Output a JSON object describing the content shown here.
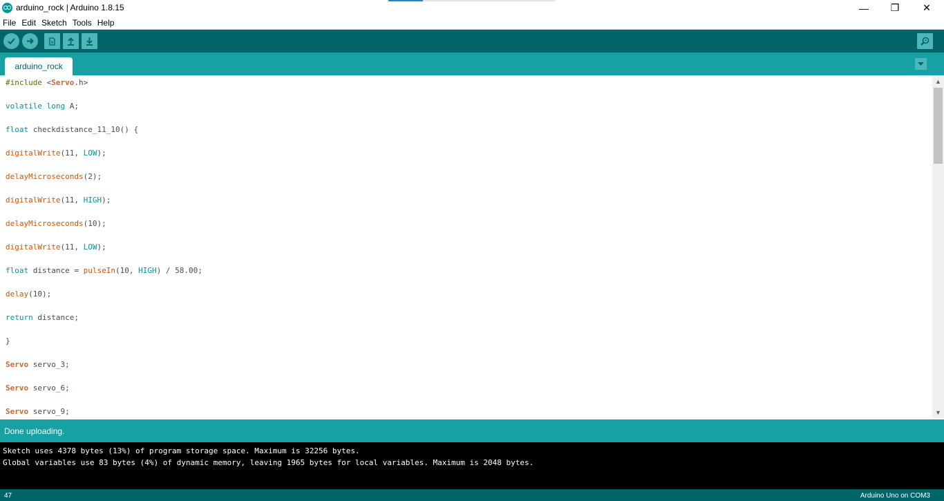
{
  "window": {
    "title": "arduino_rock | Arduino 1.8.15",
    "minimize_glyph": "—",
    "maximize_glyph": "❐",
    "close_glyph": "✕"
  },
  "menu": [
    "File",
    "Edit",
    "Sketch",
    "Tools",
    "Help"
  ],
  "toolbar": {
    "verify_icon": "checkmark-icon",
    "upload_icon": "arrow-right-icon",
    "new_icon": "document-icon",
    "open_icon": "arrow-up-icon",
    "save_icon": "arrow-down-icon",
    "serial_monitor_icon": "magnifier-icon"
  },
  "tabs": [
    {
      "label": "arduino_rock"
    }
  ],
  "editor": {
    "lines": [
      "#include <Servo.h>",
      "volatile long A;",
      "float checkdistance_11_10() {",
      "digitalWrite(11, LOW);",
      "delayMicroseconds(2);",
      "digitalWrite(11, HIGH);",
      "delayMicroseconds(10);",
      "digitalWrite(11, LOW);",
      "float distance = pulseIn(10, HIGH) / 58.00;",
      "delay(10);",
      "return distance;",
      "}",
      "Servo servo_3;",
      "Servo servo_6;",
      "Servo servo_9;"
    ]
  },
  "status": {
    "message": "Done uploading."
  },
  "console": {
    "lines": [
      "Sketch uses 4378 bytes (13%) of program storage space. Maximum is 32256 bytes.",
      "Global variables use 83 bytes (4%) of dynamic memory, leaving 1965 bytes for local variables. Maximum is 2048 bytes."
    ]
  },
  "footer": {
    "line_number": "47",
    "board": "Arduino Uno on COM3"
  },
  "colors": {
    "toolbar": "#006468",
    "tabbar": "#17a1a5",
    "button": "#4db7bb"
  }
}
